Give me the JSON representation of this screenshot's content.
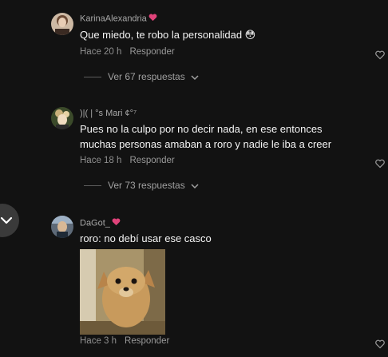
{
  "comments": [
    {
      "username": "KarinaAlexandria",
      "text": "Que miedo, te robo la personalidad 😳",
      "time": "Hace 20 h",
      "reply_label": "Responder",
      "replies_label": "Ver 67 respuestas"
    },
    {
      "username": ")|( | °s Mari ¢°⁷",
      "text": "Pues no la culpo por no decir nada, en ese entonces muchas personas amaban a roro y nadie le iba a creer",
      "time": "Hace 18 h",
      "reply_label": "Responder",
      "replies_label": "Ver 73 respuestas"
    },
    {
      "username": "DaGot_",
      "text": "roro: no debí usar ese casco",
      "time": "Hace 3 h",
      "reply_label": "Responder"
    }
  ],
  "icons": {
    "heart": "heart-icon",
    "chevron": "chevron-down-icon",
    "username_heart": "pink-heart-icon"
  },
  "colors": {
    "background": "#121212",
    "pink_heart": "#e0437a"
  }
}
